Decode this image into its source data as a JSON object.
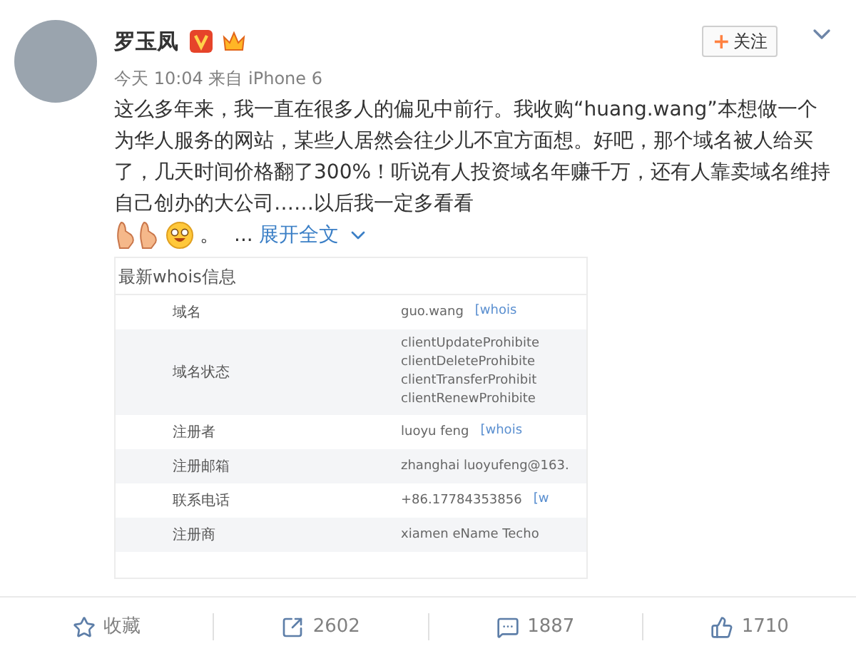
{
  "author": {
    "name": "罗玉凤",
    "time": "今天 10:04 来自 iPhone 6"
  },
  "follow_button": {
    "plus": "+",
    "label": "关注"
  },
  "post": {
    "text": "这么多年来，我一直在很多人的偏见中前行。我收购“huang.wang”本想做一个为华人服务的网站，某些人居然会往少儿不宜方面想。好吧，那个域名被人给买了，几天时间价格翻了300%！听说有人投资域名年赚千万，还有人靠卖域名维持自己创办的大公司……以后我一定多看看",
    "after_emoji": "。",
    "ellipsis": "...",
    "expand": "展开全文"
  },
  "whois": {
    "title": "最新whois信息",
    "rows": [
      {
        "label": "域名",
        "values": [
          "guo.wang"
        ],
        "link": "[whois"
      },
      {
        "label": "域名状态",
        "values": [
          "clientUpdateProhibite",
          "clientDeleteProhibite",
          "clientTransferProhibit",
          "clientRenewProhibite"
        ]
      },
      {
        "label": "注册者",
        "values": [
          "luoyu feng"
        ],
        "link": "[whois"
      },
      {
        "label": "注册邮箱",
        "values": [
          "zhanghai luoyufeng@163."
        ]
      },
      {
        "label": "联系电话",
        "values": [
          "+86.17784353856"
        ],
        "link": "[w"
      },
      {
        "label": "注册商",
        "values": [
          "xiamen eName Techo"
        ]
      }
    ]
  },
  "actions": [
    {
      "kind": "favorite",
      "label": "收藏"
    },
    {
      "kind": "repost",
      "label": "2602"
    },
    {
      "kind": "comment",
      "label": "1887"
    },
    {
      "kind": "like",
      "label": "1710"
    }
  ]
}
